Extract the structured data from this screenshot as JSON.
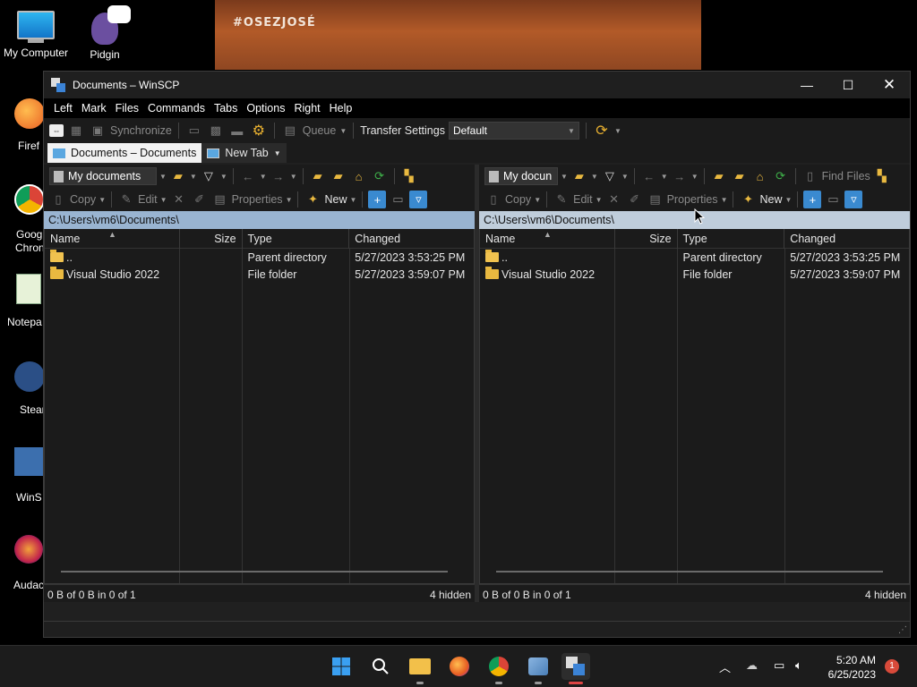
{
  "desktop": {
    "banner_text": "#OSEZJOSÉ",
    "icons": [
      {
        "label": "My Computer",
        "icon": "monitor-icon"
      },
      {
        "label": "Pidgin",
        "icon": "pidgin-icon"
      }
    ],
    "clipped_labels": [
      "Firef",
      "Goog",
      "Chron",
      "Notepa",
      "Stear",
      "WinS",
      "Audac"
    ]
  },
  "window": {
    "title": "Documents – WinSCP",
    "controls": {
      "minimize": "—",
      "maximize": "☐",
      "close": "✕"
    },
    "menu": [
      "Left",
      "Mark",
      "Files",
      "Commands",
      "Tabs",
      "Options",
      "Right",
      "Help"
    ],
    "toolbar": {
      "synchronize": "Synchronize",
      "queue": "Queue",
      "transfer_settings_label": "Transfer Settings",
      "transfer_settings_value": "Default"
    },
    "tabs": [
      {
        "label": "Documents – Documents",
        "active": true
      },
      {
        "label": "New Tab",
        "active": false
      }
    ]
  },
  "left_pane": {
    "location": "My documents",
    "actions": {
      "copy": "Copy",
      "edit": "Edit",
      "properties": "Properties",
      "new": "New"
    },
    "path": "C:\\Users\\vm6\\Documents\\",
    "columns": {
      "name": "Name",
      "size": "Size",
      "type": "Type",
      "changed": "Changed"
    },
    "rows": [
      {
        "name": "..",
        "size": "",
        "type": "Parent directory",
        "changed": "5/27/2023 3:53:25 PM"
      },
      {
        "name": "Visual Studio 2022",
        "size": "",
        "type": "File folder",
        "changed": "5/27/2023 3:59:07 PM"
      }
    ],
    "status_left": "0 B of 0 B in 0 of 1",
    "status_right": "4 hidden"
  },
  "right_pane": {
    "location": "My docun",
    "find_files": "Find Files",
    "actions": {
      "copy": "Copy",
      "edit": "Edit",
      "properties": "Properties",
      "new": "New"
    },
    "path": "C:\\Users\\vm6\\Documents\\",
    "columns": {
      "name": "Name",
      "size": "Size",
      "type": "Type",
      "changed": "Changed"
    },
    "rows": [
      {
        "name": "..",
        "size": "",
        "type": "Parent directory",
        "changed": "5/27/2023 3:53:25 PM"
      },
      {
        "name": "Visual Studio 2022",
        "size": "",
        "type": "File folder",
        "changed": "5/27/2023 3:59:07 PM"
      }
    ],
    "status_left": "0 B of 0 B in 0 of 1",
    "status_right": "4 hidden"
  },
  "taskbar": {
    "time": "5:20 AM",
    "date": "6/25/2023",
    "notification_count": "1"
  },
  "colors": {
    "path_active": "#99b4d1",
    "path_inactive": "#bfcddb",
    "folder": "#e9b940",
    "window_bg": "#202020"
  }
}
